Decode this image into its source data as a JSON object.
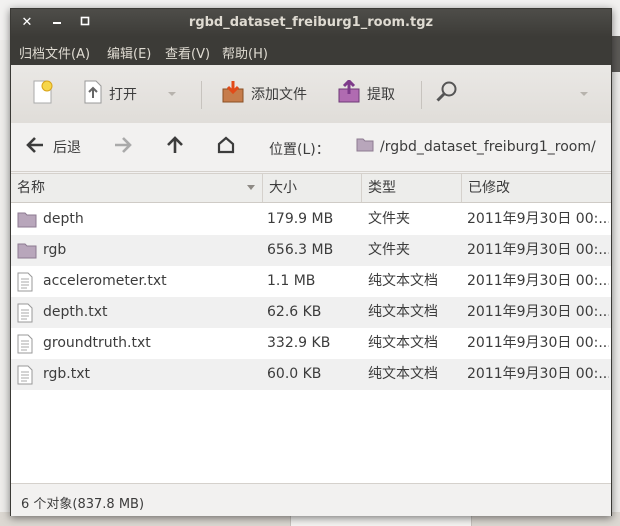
{
  "window": {
    "title": "rgbd_dataset_freiburg1_room.tgz"
  },
  "menu": [
    "归档文件(A)",
    "编辑(E)",
    "查看(V)",
    "帮助(H)"
  ],
  "toolbar": {
    "open": "打开",
    "add_files": "添加文件",
    "extract": "提取"
  },
  "nav": {
    "back": "后退",
    "location_label": "位置(L)：",
    "path": "/rgbd_dataset_freiburg1_room/"
  },
  "columns": {
    "name": "名称",
    "size": "大小",
    "type": "类型",
    "modified": "已修改"
  },
  "files": [
    {
      "name": "depth",
      "size": "179.9 MB",
      "type": "文件夹",
      "modified": "2011年9月30日 00:...",
      "icon": "folder-icon"
    },
    {
      "name": "rgb",
      "size": "656.3 MB",
      "type": "文件夹",
      "modified": "2011年9月30日 00:...",
      "icon": "folder-icon"
    },
    {
      "name": "accelerometer.txt",
      "size": "1.1 MB",
      "type": "纯文本文档",
      "modified": "2011年9月30日 00:...",
      "icon": "text-file-icon"
    },
    {
      "name": "depth.txt",
      "size": "62.6 KB",
      "type": "纯文本文档",
      "modified": "2011年9月30日 00:...",
      "icon": "text-file-icon"
    },
    {
      "name": "groundtruth.txt",
      "size": "332.9 KB",
      "type": "纯文本文档",
      "modified": "2011年9月30日 00:...",
      "icon": "text-file-icon"
    },
    {
      "name": "rgb.txt",
      "size": "60.0 KB",
      "type": "纯文本文档",
      "modified": "2011年9月30日 00:...",
      "icon": "text-file-icon"
    }
  ],
  "status": "6 个对象(837.8 MB)"
}
